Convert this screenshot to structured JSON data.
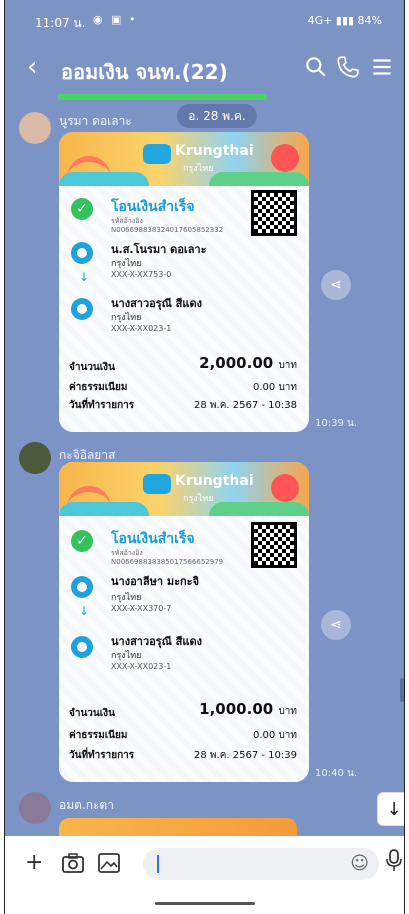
{
  "status_bar": {
    "time": "11:07 น.",
    "network": "4G+",
    "battery": "84%"
  },
  "header": {
    "back_icon": "chevron-left-icon",
    "title": "ออมเงิน จนท.(22)",
    "search_icon": "search-icon",
    "call_icon": "phone-icon",
    "menu_icon": "menu-icon"
  },
  "messages": [
    {
      "sender": "นูรมา ดอเลาะ",
      "date_chip": "อ. 28 พ.ค.",
      "time": "10:39 น.",
      "slip": {
        "brand": "Krungthai",
        "brand_sub": "กรุงไทย",
        "status": "โอนเงินสำเร็จ",
        "ref_label": "รหัสอ้างอิง",
        "ref": "N006698838324017605852332",
        "from": {
          "name": "น.ส.โนรมา ดอเลาะ",
          "bank": "กรุงไทย",
          "account": "XXX-X-XX753-0"
        },
        "to": {
          "name": "นางสาวอรุณี สีแดง",
          "bank": "กรุงไทย",
          "account": "XXX-X-XX023-1"
        },
        "amount_label": "จำนวนเงิน",
        "amount": "2,000.00",
        "fee_label": "ค่าธรรมเนียม",
        "fee": "0.00 บาท",
        "date_label": "วันที่ทำรายการ",
        "date": "28 พ.ค. 2567 - 10:38",
        "currency": "บาท"
      }
    },
    {
      "sender": "กะจิอิลยาส",
      "time": "10:40 น.",
      "slip": {
        "brand": "Krungthai",
        "brand_sub": "กรุงไทย",
        "status": "โอนเงินสำเร็จ",
        "ref_label": "รหัสอ้างอิง",
        "ref": "N006698838385017566652979",
        "from": {
          "name": "นางอาลีษา มะกะจิ",
          "bank": "กรุงไทย",
          "account": "XXX-X-XX370-7"
        },
        "to": {
          "name": "นางสาวอรุณี สีแดง",
          "bank": "กรุงไทย",
          "account": "XXX-X-XX023-1"
        },
        "amount_label": "จำนวนเงิน",
        "amount": "1,000.00",
        "fee_label": "ค่าธรรมเนียม",
        "fee": "0.00 บาท",
        "date_label": "วันที่ทำรายการ",
        "date": "28 พ.ค. 2567 - 10:39",
        "currency": "บาท"
      }
    },
    {
      "sender": "อมต.กะตา"
    }
  ],
  "input_bar": {
    "icons": [
      "plus-icon",
      "camera-icon",
      "image-icon",
      "emoji-icon",
      "mic-icon"
    ]
  },
  "colors": {
    "chat_bg": "#7b93c5",
    "accent_blue": "#1b9cd8",
    "success_green": "#35c15c"
  }
}
